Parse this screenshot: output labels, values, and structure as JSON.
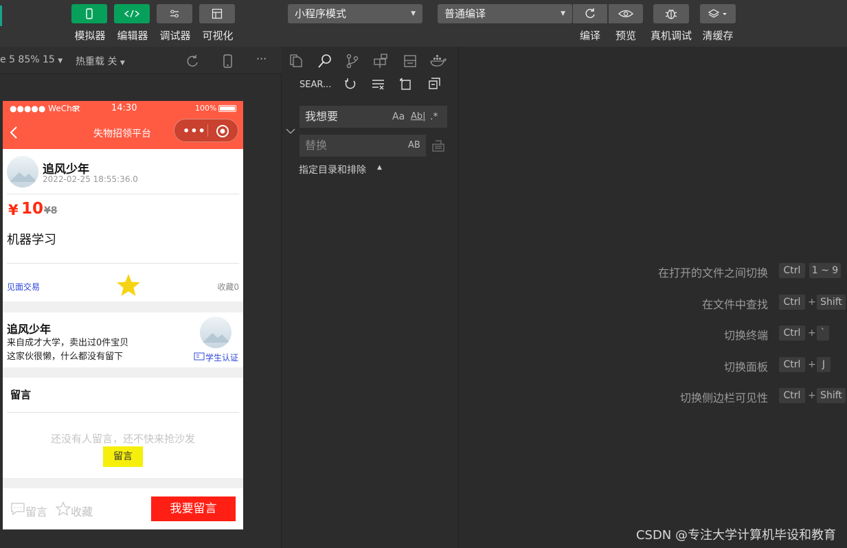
{
  "toolbar": {
    "buttons": [
      {
        "label": "模拟器",
        "icon": "phone-icon"
      },
      {
        "label": "编辑器",
        "icon": "code-icon"
      },
      {
        "label": "调试器",
        "icon": "sliders-icon"
      },
      {
        "label": "可视化",
        "icon": "layout-icon"
      }
    ],
    "mode_select": "小程序模式",
    "compile_select": "普通编译",
    "actions": [
      {
        "label": "编译",
        "icon": "refresh-icon"
      },
      {
        "label": "预览",
        "icon": "eye-icon"
      },
      {
        "label": "真机调试",
        "icon": "bug-icon"
      },
      {
        "label": "清缓存",
        "icon": "layers-icon"
      }
    ]
  },
  "simulator_bar": {
    "device": "e 5 85% 15",
    "hot_reload": "热重载 关",
    "more": "···"
  },
  "phone": {
    "status": {
      "carrier": "●●●●● WeChat",
      "time": "14:30",
      "battery": "100%"
    },
    "nav_title": "失物招领平台",
    "post": {
      "user_name": "追风少年",
      "date": "2022-02-25 18:55:36.0",
      "price_symbol": "¥",
      "price": "10",
      "original_price": "¥8",
      "title": "机器学习",
      "trade_type": "见面交易",
      "favorites": "收藏0"
    },
    "seller": {
      "name": "追风少年",
      "school": "来自成才大学，卖出过0件宝贝",
      "bio": "这家伙很懒，什么都没有留下",
      "badge": "学生认证"
    },
    "comments": {
      "title": "留言",
      "empty_text": "还没有人留言，还不快来抢沙发",
      "button": "留言"
    },
    "bottom": {
      "comment": "留言",
      "favorite": "收藏",
      "primary": "我要留言"
    }
  },
  "search_panel": {
    "label": "SEAR...",
    "find_value": "我想要",
    "match_case": "Aa",
    "whole_word": "Ab|",
    "regex": ".*",
    "replace_placeholder": "替换",
    "preserve_case": "AB",
    "include_exclude": "指定目录和排除"
  },
  "shortcuts": [
    {
      "label": "在打开的文件之间切换",
      "keys": [
        "Ctrl",
        "1 ~ 9"
      ],
      "plus": false
    },
    {
      "label": "在文件中查找",
      "keys": [
        "Ctrl",
        "Shift"
      ],
      "plus": true
    },
    {
      "label": "切换终端",
      "keys": [
        "Ctrl",
        "`"
      ],
      "plus": true
    },
    {
      "label": "切换面板",
      "keys": [
        "Ctrl",
        "J"
      ],
      "plus": true
    },
    {
      "label": "切换侧边栏可见性",
      "keys": [
        "Ctrl",
        "Shift"
      ],
      "plus": true
    }
  ],
  "watermark": "CSDN @专注大学计算机毕设和教育",
  "colors": {
    "accent_green": "#07a05b",
    "nav_red": "#ff5a42",
    "price_red": "#ff2a12",
    "primary_button": "#ff1f14",
    "comment_button": "#f5ef0b",
    "star": "#f6d313"
  }
}
